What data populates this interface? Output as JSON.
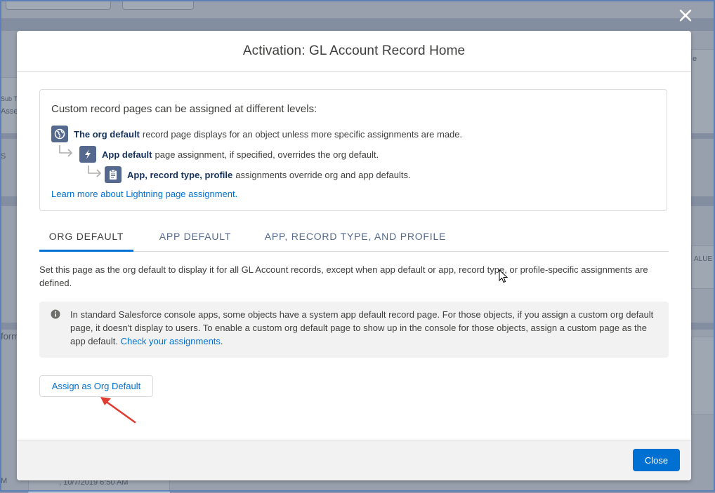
{
  "modal": {
    "title": "Activation: GL Account Record Home",
    "info": {
      "heading": "Custom record pages can be assigned at different levels:",
      "levels": [
        {
          "icon": "globe-icon",
          "bold": "The org default",
          "text": "record page displays for an object unless more specific assignments are made."
        },
        {
          "icon": "lightning-bolt-icon",
          "bold": "App default",
          "text": "page assignment, if specified, overrides the org default."
        },
        {
          "icon": "clipboard-icon",
          "bold": "App, record type, profile",
          "text": "assignments override org and app defaults."
        }
      ],
      "learn_link": "Learn more about Lightning page assignment."
    },
    "tabs": [
      {
        "label": "ORG DEFAULT",
        "active": true
      },
      {
        "label": "APP DEFAULT",
        "active": false
      },
      {
        "label": "APP, RECORD TYPE, AND PROFILE",
        "active": false
      }
    ],
    "description": "Set this page as the org default to display it for all GL Account records, except when app default or app, record type, or profile-specific assignments are defined.",
    "note": {
      "icon": "info-icon",
      "text": "In standard Salesforce console apps, some objects have a system app default record page. For those objects, if you assign a custom org default page, it doesn't display to users. To enable a custom org default page to show up in the console for those objects, assign a custom page as the app default.",
      "link": "Check your assignments",
      "link_suffix": "."
    },
    "assign_button": "Assign as Org Default",
    "close_button": "Close"
  },
  "background": {
    "fragments": [
      "Sub T",
      "Asse",
      "S",
      "form",
      "ALUE",
      "e",
      "M",
      ", 10/7/2019 6:50 AM"
    ]
  },
  "colors": {
    "brand": "#0070d2",
    "icon_bg": "#54698d",
    "annotation_arrow": "#e03c31"
  }
}
